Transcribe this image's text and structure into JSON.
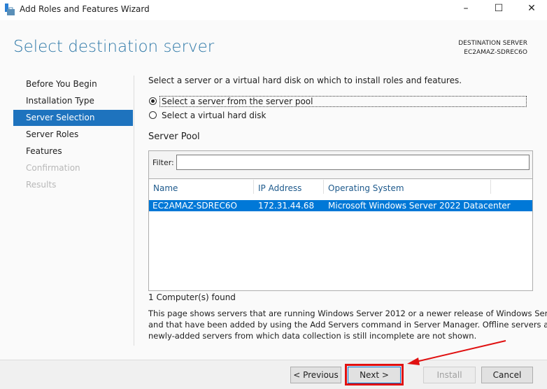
{
  "window": {
    "title": "Add Roles and Features Wizard",
    "minimize": "–",
    "maximize": "☐",
    "close": "✕"
  },
  "header": {
    "title": "Select destination server",
    "dest_label": "DESTINATION SERVER",
    "dest_server": "EC2AMAZ-SDREC6O"
  },
  "sidebar": {
    "items": [
      {
        "label": "Before You Begin",
        "state": "normal"
      },
      {
        "label": "Installation Type",
        "state": "normal"
      },
      {
        "label": "Server Selection",
        "state": "selected"
      },
      {
        "label": "Server Roles",
        "state": "normal"
      },
      {
        "label": "Features",
        "state": "normal"
      },
      {
        "label": "Confirmation",
        "state": "disabled"
      },
      {
        "label": "Results",
        "state": "disabled"
      }
    ]
  },
  "main": {
    "instruction": "Select a server or a virtual hard disk on which to install roles and features.",
    "radio_pool": "Select a server from the server pool",
    "radio_vhd": "Select a virtual hard disk",
    "pool_title": "Server Pool",
    "filter_label": "Filter:",
    "filter_value": "",
    "columns": [
      "Name",
      "IP Address",
      "Operating System"
    ],
    "rows": [
      {
        "name": "EC2AMAZ-SDREC6O",
        "ip": "172.31.44.68",
        "os": "Microsoft Windows Server 2022 Datacenter"
      }
    ],
    "count": "1 Computer(s) found",
    "description": [
      "This page shows servers that are running Windows Server 2012 or a newer release of Windows Server,",
      "and that have been added by using the Add Servers command in Server Manager. Offline servers and",
      "newly-added servers from which data collection is still incomplete are not shown."
    ]
  },
  "buttons": {
    "previous": "< Previous",
    "next": "Next >",
    "install": "Install",
    "cancel": "Cancel"
  },
  "colors": {
    "accent": "#1e73be",
    "selection": "#0078d7",
    "annotation": "#e01010"
  }
}
